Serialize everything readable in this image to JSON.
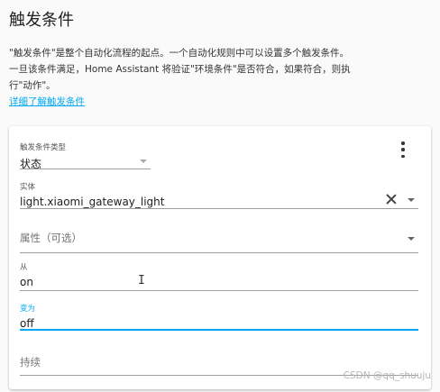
{
  "page": {
    "title": "触发条件",
    "intro_line1": "\"触发条件\"是整个自动化流程的起点。一个自动化规则中可以设置多个触发条件。",
    "intro_line2": "一旦该条件满足，Home Assistant 将验证\"环境条件\"是否符合，如果符合，则执",
    "intro_line3": "行\"动作\"。",
    "learn_more_link": "详细了解触发条件"
  },
  "card": {
    "trigger_type": {
      "label": "触发条件类型",
      "value": "状态"
    },
    "entity": {
      "label": "实体",
      "value": "light.xiaomi_gateway_light"
    },
    "attribute": {
      "placeholder": "属性（可选）"
    },
    "from": {
      "label": "从",
      "value": "on"
    },
    "to": {
      "label": "变为",
      "value": "off"
    },
    "duration": {
      "placeholder": "持续"
    }
  },
  "watermark": "CSDN @qq_shuuju",
  "colors": {
    "accent": "#03a9f4",
    "background": "#fafafa",
    "card": "#ffffff"
  },
  "icons": {
    "menu": "more-vert-icon",
    "clear": "close-icon",
    "dropdown": "arrow-drop-down-icon",
    "text_cursor": "text-cursor-icon"
  }
}
